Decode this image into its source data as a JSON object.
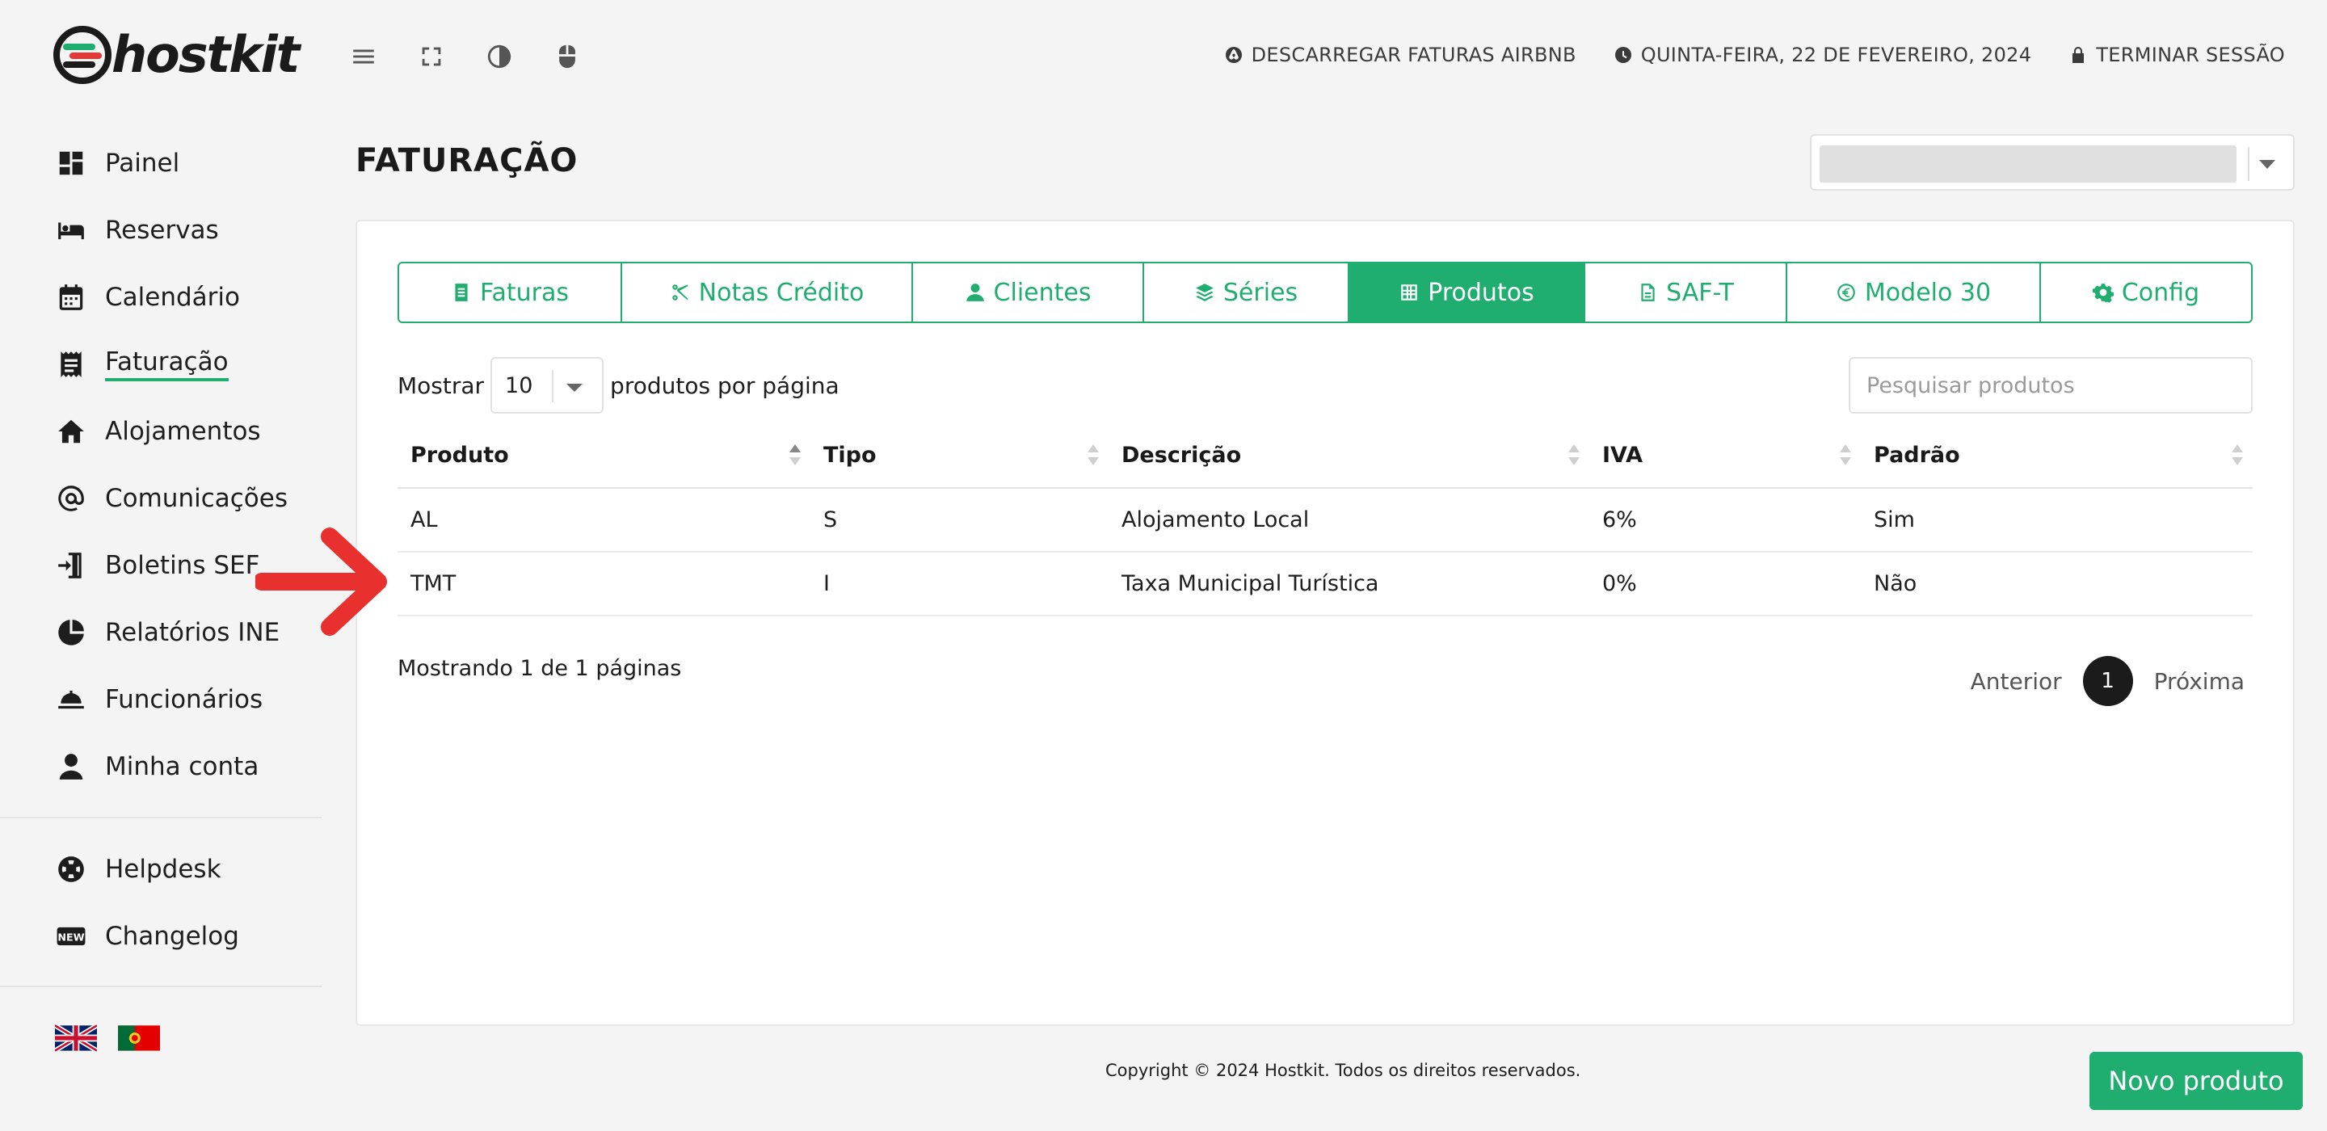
{
  "brand": {
    "name": "hostkit",
    "accent": "#1fae6f",
    "logo_colors": [
      "#1fae6f",
      "#e53935"
    ]
  },
  "topbar": {
    "tools": [
      {
        "icon": "menu-icon"
      },
      {
        "icon": "fullscreen-icon"
      },
      {
        "icon": "contrast-icon"
      },
      {
        "icon": "mouse-icon"
      }
    ],
    "airbnb_link": "DESCARREGAR FATURAS AIRBNB",
    "date": "QUINTA-FEIRA, 22 DE FEVEREIRO, 2024",
    "logout": "TERMINAR SESSÃO"
  },
  "sidebar": {
    "items": [
      {
        "label": "Painel",
        "icon": "dashboard-icon"
      },
      {
        "label": "Reservas",
        "icon": "bed-icon"
      },
      {
        "label": "Calendário",
        "icon": "calendar-icon"
      },
      {
        "label": "Faturação",
        "icon": "invoice-icon",
        "active": true
      },
      {
        "label": "Alojamentos",
        "icon": "home-icon"
      },
      {
        "label": "Comunicações",
        "icon": "at-icon"
      },
      {
        "label": "Boletins SEF",
        "icon": "door-enter-icon"
      },
      {
        "label": "Relatórios INE",
        "icon": "pie-chart-icon"
      },
      {
        "label": "Funcionários",
        "icon": "service-bell-icon"
      },
      {
        "label": "Minha conta",
        "icon": "user-icon"
      }
    ],
    "secondary": [
      {
        "label": "Helpdesk",
        "icon": "lifebuoy-icon"
      },
      {
        "label": "Changelog",
        "icon": "new-badge-icon"
      }
    ],
    "languages": [
      "uk-flag-icon",
      "portugal-flag-icon"
    ]
  },
  "page": {
    "title": "FATURAÇÃO"
  },
  "tabs": [
    {
      "label": "Faturas",
      "icon": "document-icon"
    },
    {
      "label": "Notas Crédito",
      "icon": "scissors-icon"
    },
    {
      "label": "Clientes",
      "icon": "users-icon"
    },
    {
      "label": "Séries",
      "icon": "layers-icon"
    },
    {
      "label": "Produtos",
      "icon": "grid-icon",
      "active": true
    },
    {
      "label": "SAF-T",
      "icon": "file-icon"
    },
    {
      "label": "Modelo 30",
      "icon": "euro-icon"
    },
    {
      "label": "Config",
      "icon": "gear-icon"
    }
  ],
  "table_controls": {
    "show_label": "Mostrar",
    "page_length": "10",
    "per_page_label": "produtos por página",
    "search_placeholder": "Pesquisar produtos"
  },
  "table": {
    "columns": [
      "Produto",
      "Tipo",
      "Descrição",
      "IVA",
      "Padrão"
    ],
    "rows": [
      [
        "AL",
        "S",
        "Alojamento Local",
        "6%",
        "Sim"
      ],
      [
        "TMT",
        "I",
        "Taxa Municipal Turística",
        "0%",
        "Não"
      ]
    ]
  },
  "pagination": {
    "info": "Mostrando 1 de 1 páginas",
    "prev": "Anterior",
    "current": "1",
    "next": "Próxima"
  },
  "footer": {
    "copyright": "Copyright © 2024 Hostkit. Todos os direitos reservados."
  },
  "actions": {
    "new_product": "Novo produto"
  },
  "annotation": {
    "arrow_color": "#e8312f"
  }
}
